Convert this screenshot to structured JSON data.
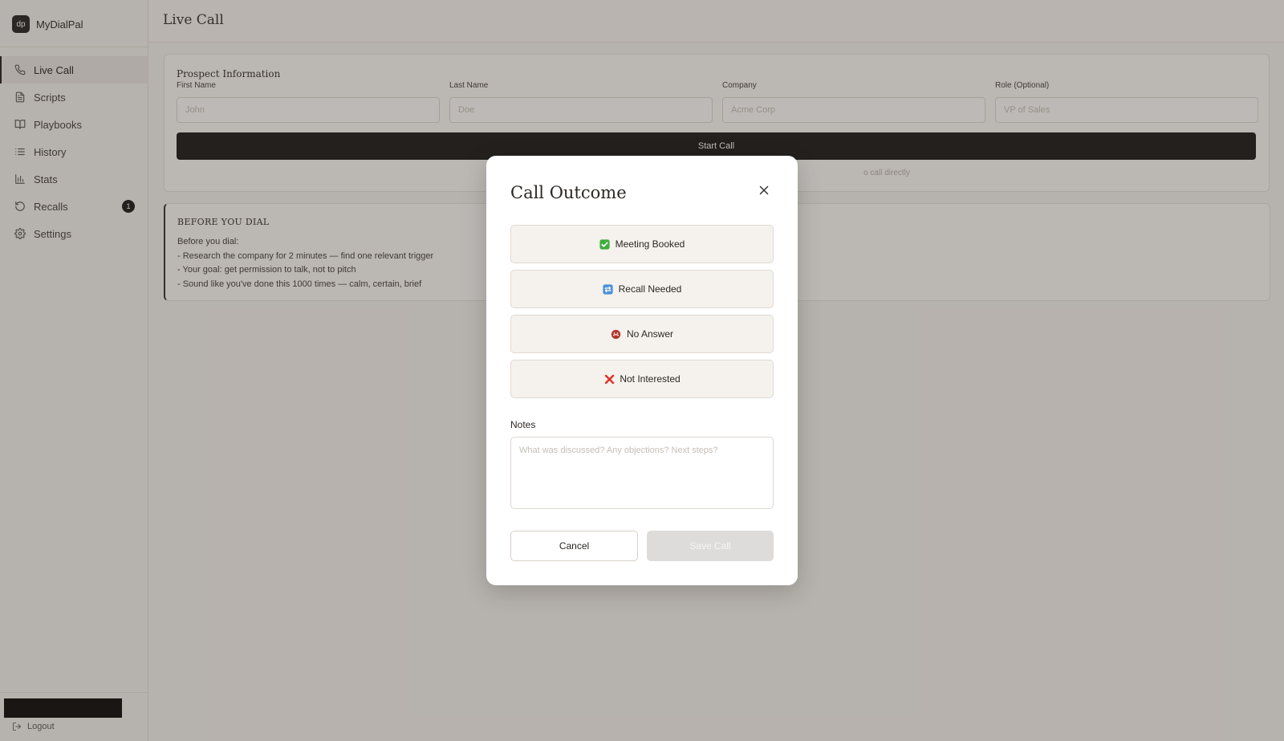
{
  "app": {
    "logo_text": "dp",
    "name": "MyDialPal"
  },
  "sidebar": {
    "items": [
      {
        "label": "Live Call",
        "icon": "phone-icon",
        "active": true
      },
      {
        "label": "Scripts",
        "icon": "file-text-icon"
      },
      {
        "label": "Playbooks",
        "icon": "book-open-icon"
      },
      {
        "label": "History",
        "icon": "list-icon"
      },
      {
        "label": "Stats",
        "icon": "bar-chart-icon"
      },
      {
        "label": "Recalls",
        "icon": "rotate-ccw-icon",
        "badge": "1"
      },
      {
        "label": "Settings",
        "icon": "gear-icon"
      }
    ],
    "logout_label": "Logout"
  },
  "header": {
    "title": "Live Call"
  },
  "prospect": {
    "title": "Prospect Information",
    "fields": [
      {
        "label": "First Name",
        "placeholder": "John",
        "value": ""
      },
      {
        "label": "Last Name",
        "placeholder": "Doe",
        "value": ""
      },
      {
        "label": "Company",
        "placeholder": "Acme Corp",
        "value": ""
      },
      {
        "label": "Role (Optional)",
        "placeholder": "VP of Sales",
        "value": ""
      }
    ],
    "start_button": "Start Call",
    "hint_partial": "o call directly"
  },
  "tips": {
    "title": "BEFORE YOU DIAL",
    "lines": [
      "Before you dial:",
      "- Research the company for 2 minutes — find one relevant trigger",
      "- Your goal: get permission to talk, not to pitch",
      "- Sound like you've done this 1000 times — calm, certain, brief"
    ]
  },
  "modal": {
    "title": "Call Outcome",
    "outcomes": [
      {
        "label": "Meeting Booked",
        "icon": "check-box-icon",
        "color": "#3fae3f"
      },
      {
        "label": "Recall Needed",
        "icon": "repeat-box-icon",
        "color": "#4a8fd8"
      },
      {
        "label": "No Answer",
        "icon": "no-answer-icon",
        "color": "#b03a2e"
      },
      {
        "label": "Not Interested",
        "icon": "cross-mark-icon",
        "color": "#e0322a"
      }
    ],
    "notes_label": "Notes",
    "notes_placeholder": "What was discussed? Any objections? Next steps?",
    "cancel_label": "Cancel",
    "save_label": "Save Call"
  },
  "colors": {
    "accent": "#111111",
    "background": "#f6f4f1",
    "overlay": "#6e655c"
  }
}
